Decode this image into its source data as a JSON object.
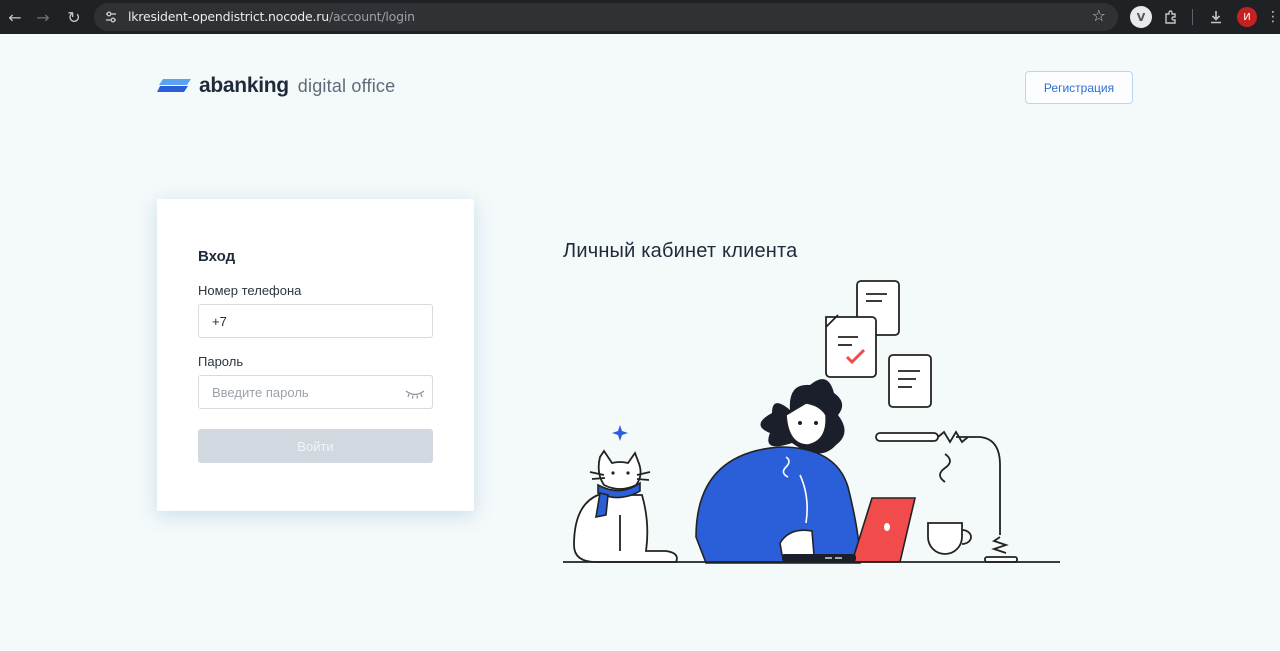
{
  "browser": {
    "url_host": "lkresident-opendistrict.nocode.ru",
    "url_path": "/account/login",
    "profile_initial": "И",
    "extension_letter": "V"
  },
  "header": {
    "brand": "abanking",
    "brand_sub": "digital office",
    "register_label": "Регистрация"
  },
  "login": {
    "title": "Вход",
    "phone_label": "Номер телефона",
    "phone_value": "+7",
    "password_label": "Пароль",
    "password_placeholder": "Введите пароль",
    "submit_label": "Войти"
  },
  "promo": {
    "title": "Личный кабинет клиента"
  },
  "colors": {
    "accent": "#2f6fd1",
    "brand_blue": "#2b5fd9",
    "laptop_red": "#f24b4b",
    "text_dark": "#1f2a3a"
  }
}
